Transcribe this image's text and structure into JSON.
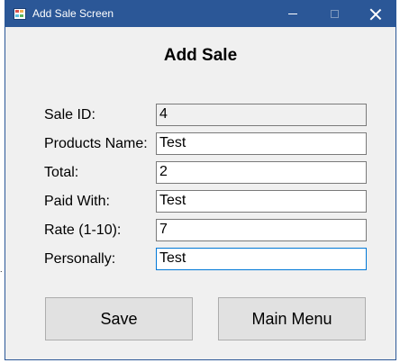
{
  "window": {
    "title": "Add Sale Screen",
    "app_icon": "form-app-icon",
    "controls": [
      "minimize-icon",
      "maximize-icon",
      "close-icon"
    ]
  },
  "form": {
    "heading": "Add Sale",
    "fields": [
      {
        "label": "Sale ID:",
        "value": "4",
        "readonly": true
      },
      {
        "label": "Products Name:",
        "value": "Test"
      },
      {
        "label": "Total:",
        "value": "2"
      },
      {
        "label": "Paid With:",
        "value": "Test"
      },
      {
        "label": "Rate (1-10):",
        "value": "7"
      },
      {
        "label": "Personally:",
        "value": "Test",
        "focused": true
      }
    ]
  },
  "buttons": {
    "save": "Save",
    "main_menu": "Main Menu"
  },
  "colors": {
    "titlebar": "#2b5797",
    "window_bg": "#f0f0f0",
    "focus_border": "#0078d7"
  }
}
